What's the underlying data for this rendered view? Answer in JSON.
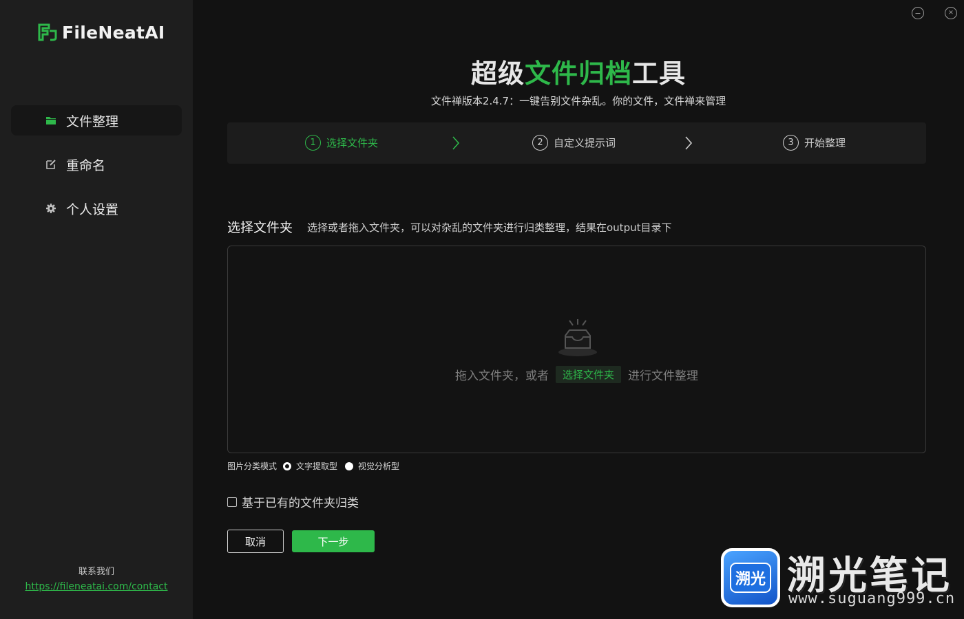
{
  "app": {
    "logo_text": "FileNeatAI",
    "accent_color": "#2eb84a"
  },
  "window_controls": [
    {
      "icon": "minimize-icon",
      "glyph": "−"
    },
    {
      "icon": "close-icon",
      "glyph": "✕"
    }
  ],
  "sidebar": {
    "items": [
      {
        "label": "文件整理",
        "icon": "folder-icon",
        "active": true
      },
      {
        "label": "重命名",
        "icon": "edit-icon",
        "active": false
      },
      {
        "label": "个人设置",
        "icon": "gear-icon",
        "active": false
      }
    ],
    "contact_title": "联系我们",
    "contact_link": "https://fileneatai.com/contact"
  },
  "header": {
    "title_part1": "超级",
    "title_highlight": "文件归档",
    "title_part2": "工具",
    "subtitle": "文件禅版本2.4.7：一键告别文件杂乱。你的文件，文件禅来管理"
  },
  "steps": [
    {
      "num": "1",
      "label": "选择文件夹",
      "active": true
    },
    {
      "num": "2",
      "label": "自定义提示词",
      "active": false
    },
    {
      "num": "3",
      "label": "开始整理",
      "active": false
    }
  ],
  "section": {
    "title": "选择文件夹",
    "description": "选择或者拖入文件夹，可以对杂乱的文件夹进行归类整理，结果在output目录下"
  },
  "dropzone": {
    "text_before": "拖入文件夹，或者",
    "button_label": "选择文件夹",
    "text_after": "进行文件整理"
  },
  "image_mode": {
    "label": "图片分类模式",
    "options": [
      {
        "label": "文字提取型",
        "checked": true
      },
      {
        "label": "视觉分析型",
        "checked": false
      }
    ]
  },
  "checkbox": {
    "label": "基于已有的文件夹归类",
    "checked": false
  },
  "buttons": {
    "cancel": "取消",
    "next": "下一步"
  },
  "watermark": {
    "badge": "溯光",
    "title": "溯光笔记",
    "url": "www.suguang999.cn"
  }
}
